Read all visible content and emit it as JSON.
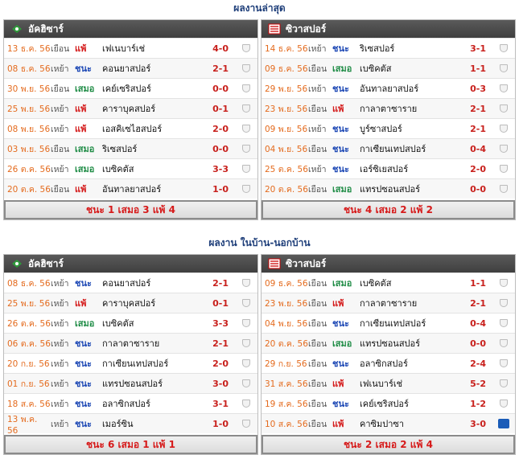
{
  "sections": [
    {
      "title": "ผลงานล่าสุด",
      "left": {
        "team": "อัคฮิซาร์",
        "rows": [
          {
            "date": "13 ธ.ค. 56",
            "venue": "เยือน",
            "result": "แพ้",
            "opponent": "เฟเนบาร์เช่",
            "score": "4-0"
          },
          {
            "date": "08 ธ.ค. 56",
            "venue": "เหย้า",
            "result": "ชนะ",
            "opponent": "คอนยาสปอร์",
            "score": "2-1"
          },
          {
            "date": "30 พ.ย. 56",
            "venue": "เยือน",
            "result": "เสมอ",
            "opponent": "เคย์เซริสปอร์",
            "score": "0-0"
          },
          {
            "date": "25 พ.ย. 56",
            "venue": "เหย้า",
            "result": "แพ้",
            "opponent": "คาราบุคสปอร์",
            "score": "0-1"
          },
          {
            "date": "08 พ.ย. 56",
            "venue": "เหย้า",
            "result": "แพ้",
            "opponent": "เอสคิเซไฮสปอร์",
            "score": "2-0"
          },
          {
            "date": "03 พ.ย. 56",
            "venue": "เยือน",
            "result": "เสมอ",
            "opponent": "ริเซสปอร์",
            "score": "0-0"
          },
          {
            "date": "26 ต.ค. 56",
            "venue": "เหย้า",
            "result": "เสมอ",
            "opponent": "เบซิคตัส",
            "score": "3-3"
          },
          {
            "date": "20 ต.ค. 56",
            "venue": "เยือน",
            "result": "แพ้",
            "opponent": "อันทาลยาสปอร์",
            "score": "1-0"
          }
        ],
        "summary": "ชนะ 1 เสมอ 3 แพ้ 4"
      },
      "right": {
        "team": "ซิวาสปอร์",
        "rows": [
          {
            "date": "14 ธ.ค. 56",
            "venue": "เหย้า",
            "result": "ชนะ",
            "opponent": "ริเซสปอร์",
            "score": "3-1"
          },
          {
            "date": "09 ธ.ค. 56",
            "venue": "เยือน",
            "result": "เสมอ",
            "opponent": "เบซิคตัส",
            "score": "1-1"
          },
          {
            "date": "29 พ.ย. 56",
            "venue": "เหย้า",
            "result": "ชนะ",
            "opponent": "อันทาลยาสปอร์",
            "score": "0-3"
          },
          {
            "date": "23 พ.ย. 56",
            "venue": "เยือน",
            "result": "แพ้",
            "opponent": "กาลาตาซาราย",
            "score": "2-1"
          },
          {
            "date": "09 พ.ย. 56",
            "venue": "เหย้า",
            "result": "ชนะ",
            "opponent": "บูร์ซาสปอร์",
            "score": "2-1"
          },
          {
            "date": "04 พ.ย. 56",
            "venue": "เยือน",
            "result": "ชนะ",
            "opponent": "กาเซียนเทปสปอร์",
            "score": "0-4"
          },
          {
            "date": "25 ต.ค. 56",
            "venue": "เหย้า",
            "result": "ชนะ",
            "opponent": "เอร์ซิเยสปอร์",
            "score": "2-0"
          },
          {
            "date": "20 ต.ค. 56",
            "venue": "เยือน",
            "result": "เสมอ",
            "opponent": "แทรปซอนสปอร์",
            "score": "0-0"
          }
        ],
        "summary": "ชนะ 4 เสมอ 2 แพ้ 2"
      }
    },
    {
      "title": "ผลงาน ในบ้าน-นอกบ้าน",
      "left": {
        "team": "อัคฮิซาร์",
        "rows": [
          {
            "date": "08 ธ.ค. 56",
            "venue": "เหย้า",
            "result": "ชนะ",
            "opponent": "คอนยาสปอร์",
            "score": "2-1"
          },
          {
            "date": "25 พ.ย. 56",
            "venue": "เหย้า",
            "result": "แพ้",
            "opponent": "คาราบุคสปอร์",
            "score": "0-1"
          },
          {
            "date": "26 ต.ค. 56",
            "venue": "เหย้า",
            "result": "เสมอ",
            "opponent": "เบซิคตัส",
            "score": "3-3"
          },
          {
            "date": "06 ต.ค. 56",
            "venue": "เหย้า",
            "result": "ชนะ",
            "opponent": "กาลาตาซาราย",
            "score": "2-1"
          },
          {
            "date": "20 ก.ย. 56",
            "venue": "เหย้า",
            "result": "ชนะ",
            "opponent": "กาเซียนเทปสปอร์",
            "score": "2-0"
          },
          {
            "date": "01 ก.ย. 56",
            "venue": "เหย้า",
            "result": "ชนะ",
            "opponent": "แทรปซอนสปอร์",
            "score": "3-0"
          },
          {
            "date": "18 ส.ค. 56",
            "venue": "เหย้า",
            "result": "ชนะ",
            "opponent": "อลาซิกสปอร์",
            "score": "3-1"
          },
          {
            "date": "13 พ.ค. 56",
            "venue": "เหย้า",
            "result": "ชนะ",
            "opponent": "เมอร์ซิน",
            "score": "1-0"
          }
        ],
        "summary": "ชนะ 6 เสมอ 1 แพ้ 1"
      },
      "right": {
        "team": "ซิวาสปอร์",
        "rows": [
          {
            "date": "09 ธ.ค. 56",
            "venue": "เยือน",
            "result": "เสมอ",
            "opponent": "เบซิคตัส",
            "score": "1-1"
          },
          {
            "date": "23 พ.ย. 56",
            "venue": "เยือน",
            "result": "แพ้",
            "opponent": "กาลาตาซาราย",
            "score": "2-1"
          },
          {
            "date": "04 พ.ย. 56",
            "venue": "เยือน",
            "result": "ชนะ",
            "opponent": "กาเซียนเทปสปอร์",
            "score": "0-4"
          },
          {
            "date": "20 ต.ค. 56",
            "venue": "เยือน",
            "result": "เสมอ",
            "opponent": "แทรปซอนสปอร์",
            "score": "0-0"
          },
          {
            "date": "29 ก.ย. 56",
            "venue": "เยือน",
            "result": "ชนะ",
            "opponent": "อลาซิกสปอร์",
            "score": "2-4"
          },
          {
            "date": "31 ส.ค. 56",
            "venue": "เยือน",
            "result": "แพ้",
            "opponent": "เฟเนบาร์เช่",
            "score": "5-2"
          },
          {
            "date": "19 ส.ค. 56",
            "venue": "เยือน",
            "result": "ชนะ",
            "opponent": "เคย์เซริสปอร์",
            "score": "1-2"
          },
          {
            "date": "10 ส.ค. 56",
            "venue": "เยือน",
            "result": "แพ้",
            "opponent": "คาซิมปาซา",
            "score": "3-0"
          }
        ],
        "summary": "ชนะ 2 เสมอ 2 แพ้ 4"
      }
    }
  ],
  "result_colors": {
    "ชนะ": "#1e49b5",
    "เสมอ": "#1f8c46",
    "แพ้": "#d41a1a"
  },
  "icons": {
    "left_team": "akhisar-crest-icon",
    "right_team": "sivasspor-crest-icon",
    "competition": "trophy-icon",
    "special": "fifa-icon"
  }
}
